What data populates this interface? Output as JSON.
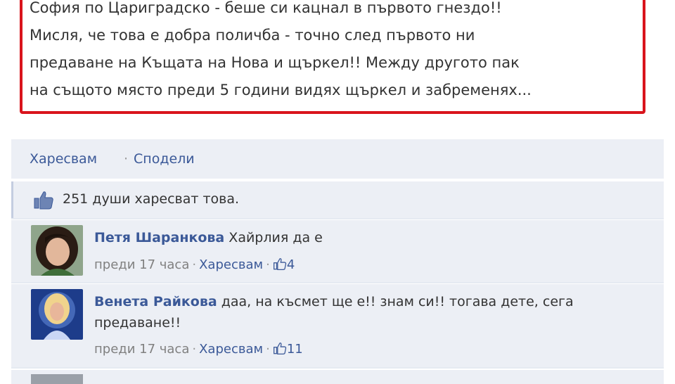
{
  "post": {
    "lines": [
      "София по Цариградско - беше си кацнал в първото гнездо!!",
      "Мисля,  че това е добра поличба - точно след първото ни",
      "предаване на Къщата на Нова и щъркел!! Между другото пак",
      "на същото място преди 5 години видях щъркел и забременях..."
    ]
  },
  "actions": {
    "like": "Харесвам",
    "separator": "·",
    "share": "Сподели"
  },
  "likes": {
    "icon": "thumbs-up-icon",
    "text": "251 души харесват това."
  },
  "comments": [
    {
      "author": "Петя Шаранкова",
      "text": "Хайрлия да е",
      "time": "преди 17 часа",
      "like": "Харесвам",
      "like_count": "4"
    },
    {
      "author": "Венета Райкова",
      "text": "даа, на късмет ще е!! знам си!! тогава дете, сега предаване!!",
      "time": "преди 17 часа",
      "like": "Харесвам",
      "like_count": "11"
    }
  ],
  "colors": {
    "link": "#3b5998",
    "highlight": "#d9141c",
    "panel": "#eceff5"
  }
}
